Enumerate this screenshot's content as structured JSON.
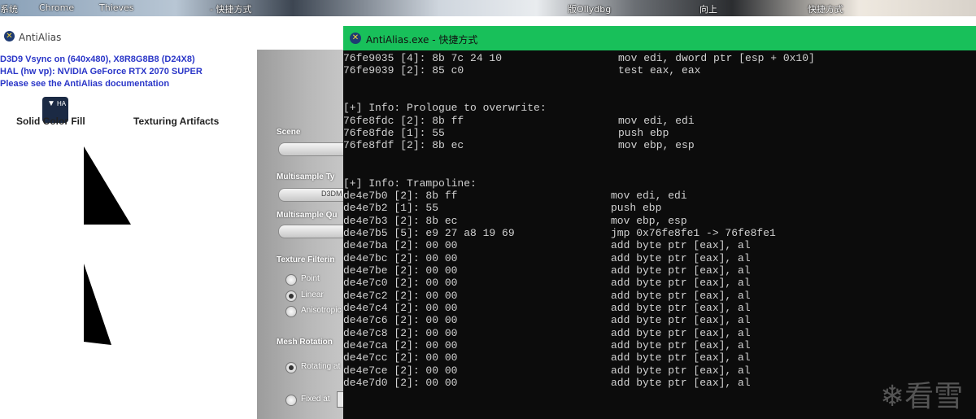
{
  "desktop": {
    "labels": [
      "系统",
      "Chrome",
      "Thieves",
      "- 快捷方式",
      "版Ollydbg",
      "向上",
      "快捷方式"
    ]
  },
  "aa_window": {
    "title": "AntiAlias",
    "info_lines": [
      "D3D9 Vsync on (640x480), X8R8G8B8 (D24X8)",
      "HAL (hw vp): NVIDIA GeForce RTX 2070 SUPER",
      "Please see the AntiAlias documentation"
    ],
    "hal_button": "HA",
    "label_solid": "Solid Color Fill",
    "label_texturing": "Texturing Artifacts",
    "panel": {
      "scene": "Scene",
      "multisample_type": "Multisample Ty",
      "multisample_type_value": "D3DM",
      "multisample_quality": "Multisample Qu",
      "texture_filtering": "Texture Filterin",
      "filter_options": [
        "Point",
        "Linear",
        "Anisotropic"
      ],
      "mesh_rotation": "Mesh Rotation",
      "rotation_options": [
        "Rotating at",
        "Fixed at"
      ]
    }
  },
  "console": {
    "title": "AntiAlias.exe - 快捷方式",
    "lines": [
      {
        "addr": "76fe9035 [4]: 8b 7c 24 10",
        "ins": "mov edi, dword ptr [esp + 0x10]"
      },
      {
        "addr": "76fe9039 [2]: 85 c0",
        "ins": "test eax, eax"
      },
      {
        "addr": "",
        "ins": ""
      },
      {
        "addr": "",
        "ins": ""
      },
      {
        "addr": "[+] Info: Prologue to overwrite:",
        "ins": ""
      },
      {
        "addr": "76fe8fdc [2]: 8b ff",
        "ins": "mov edi, edi"
      },
      {
        "addr": "76fe8fde [1]: 55",
        "ins": "push ebp"
      },
      {
        "addr": "76fe8fdf [2]: 8b ec",
        "ins": "mov ebp, esp"
      },
      {
        "addr": "",
        "ins": ""
      },
      {
        "addr": "",
        "ins": ""
      },
      {
        "addr": "[+] Info: Trampoline:",
        "ins": ""
      },
      {
        "addr": "de4e7b0 [2]: 8b ff",
        "ins": "mov edi, edi"
      },
      {
        "addr": "de4e7b2 [1]: 55",
        "ins": "push ebp"
      },
      {
        "addr": "de4e7b3 [2]: 8b ec",
        "ins": "mov ebp, esp"
      },
      {
        "addr": "de4e7b5 [5]: e9 27 a8 19 69",
        "ins": "jmp 0x76fe8fe1 -> 76fe8fe1"
      },
      {
        "addr": "de4e7ba [2]: 00 00",
        "ins": "add byte ptr [eax], al"
      },
      {
        "addr": "de4e7bc [2]: 00 00",
        "ins": "add byte ptr [eax], al"
      },
      {
        "addr": "de4e7be [2]: 00 00",
        "ins": "add byte ptr [eax], al"
      },
      {
        "addr": "de4e7c0 [2]: 00 00",
        "ins": "add byte ptr [eax], al"
      },
      {
        "addr": "de4e7c2 [2]: 00 00",
        "ins": "add byte ptr [eax], al"
      },
      {
        "addr": "de4e7c4 [2]: 00 00",
        "ins": "add byte ptr [eax], al"
      },
      {
        "addr": "de4e7c6 [2]: 00 00",
        "ins": "add byte ptr [eax], al"
      },
      {
        "addr": "de4e7c8 [2]: 00 00",
        "ins": "add byte ptr [eax], al"
      },
      {
        "addr": "de4e7ca [2]: 00 00",
        "ins": "add byte ptr [eax], al"
      },
      {
        "addr": "de4e7cc [2]: 00 00",
        "ins": "add byte ptr [eax], al"
      },
      {
        "addr": "de4e7ce [2]: 00 00",
        "ins": "add byte ptr [eax], al"
      },
      {
        "addr": "de4e7d0 [2]: 00 00",
        "ins": "add byte ptr [eax], al"
      }
    ]
  },
  "watermark": "❄看雪",
  "colors": {
    "console_title_bg": "#18c05a",
    "console_bg": "#0c0c0c",
    "console_text": "#d2d2d2",
    "info_text": "#2a36c8"
  }
}
